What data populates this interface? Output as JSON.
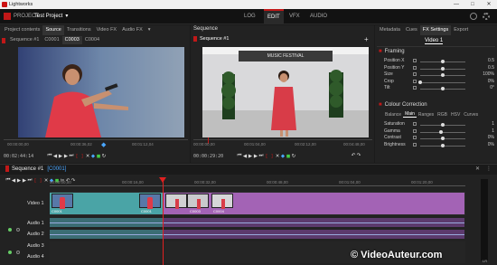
{
  "window": {
    "title": "Lightworks",
    "minimize": "—",
    "maximize": "□",
    "close": "✕"
  },
  "menubar": {
    "project_label": "PROJECT",
    "project_name": "Test Project",
    "project_dropdown": "▾",
    "tabs": [
      "LOG",
      "EDIT",
      "VFX",
      "AUDIO"
    ],
    "active_tab": "EDIT",
    "right_icons": [
      "help",
      "settings"
    ]
  },
  "left_panel": {
    "tabs": [
      "Project contents",
      "Source",
      "Transitions",
      "Video FX",
      "Audio FX"
    ],
    "active": "Source",
    "more": "▾",
    "seq_tabs": [
      "Sequence #1",
      "C0001",
      "C0003",
      "C0004"
    ],
    "active_seq": "C0003",
    "ruler": [
      "00:00:00,00",
      "00:00:36,02",
      "00:01:12,04"
    ],
    "timecode": "00:02:44:14"
  },
  "center_panel": {
    "title": "Sequence",
    "seq_tab": "Sequence #1",
    "ruler": [
      "00:00:00,00",
      "00:01:04,00",
      "00:02:12,00",
      "00:03:16,00"
    ],
    "ruler_end": "00:04:48,00",
    "timecode": "00:00:29:20",
    "sign_text": "MUSIC FESTIVAL"
  },
  "right_panel": {
    "tabs": [
      "Metadata",
      "Cues",
      "FX Settings",
      "Export"
    ],
    "active": "FX Settings",
    "target": "Video 1",
    "framing": {
      "title": "Framing",
      "rows": [
        {
          "label": "Position X",
          "value": "0.5",
          "knob": 0.5
        },
        {
          "label": "Position Y",
          "value": "0.5",
          "knob": 0.5
        },
        {
          "label": "Size",
          "value": "100%",
          "knob": 0.5
        },
        {
          "label": "Crop",
          "value": "0%",
          "knob": 0.0
        },
        {
          "label": "Tilt",
          "value": "0°",
          "knob": 0.5
        }
      ]
    },
    "colour": {
      "title": "Colour Correction",
      "tabs": [
        "Balance",
        "Main",
        "Ranges",
        "RGB",
        "HSV",
        "Curves"
      ],
      "active": "Main",
      "rows": [
        {
          "label": "Saturation",
          "value": "1",
          "knob": 0.5
        },
        {
          "label": "Gamma",
          "value": "1",
          "knob": 0.45
        },
        {
          "label": "Contrast",
          "value": "0%",
          "knob": 0.5
        },
        {
          "label": "Brightness",
          "value": "0%",
          "knob": 0.5
        }
      ]
    }
  },
  "timeline": {
    "sequence_label": "Sequence #1",
    "clip_label": "[C0001]",
    "ruler": [
      "00:00:00,00",
      "00:00:16,00",
      "00:00:32,00",
      "00:00:48,00",
      "00:01:04,00",
      "00:01:20,00"
    ],
    "tracks": [
      "Video 1",
      "Audio 1",
      "Audio 2",
      "Audio 3",
      "Audio 4"
    ],
    "clip_names": [
      "C0001",
      "C0001",
      "C0003",
      "C0004"
    ],
    "lr": "LR"
  },
  "watermark": "© VideoAuteur.com",
  "colors": {
    "accent": "#c01818",
    "teal_clip": "#4aa4a6",
    "purple_clip": "#a363b5"
  }
}
